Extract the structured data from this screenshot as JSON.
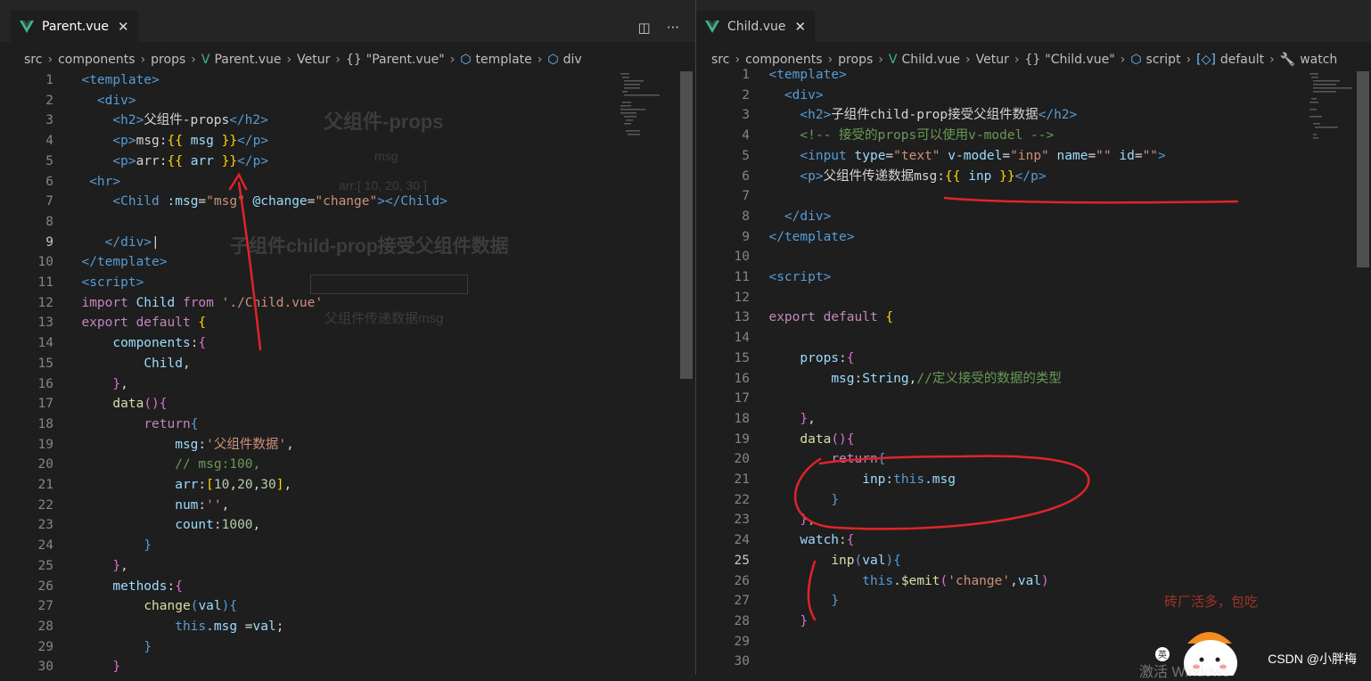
{
  "left": {
    "tab": "Parent.vue",
    "breadcrumb": [
      "src",
      "components",
      "props",
      "Parent.vue",
      "Vetur",
      "\"Parent.vue\"",
      "template",
      "div"
    ],
    "lines": [
      {
        "n": "1",
        "seg": [
          [
            "  ",
            ""
          ],
          [
            "<template>",
            "t-tag"
          ]
        ]
      },
      {
        "n": "2",
        "seg": [
          [
            "    ",
            ""
          ],
          [
            "<div>",
            "t-tag"
          ]
        ]
      },
      {
        "n": "3",
        "seg": [
          [
            "      ",
            ""
          ],
          [
            "<h2>",
            "t-tag"
          ],
          [
            "父组件-props",
            ""
          ],
          [
            "</h2>",
            "t-tag"
          ]
        ]
      },
      {
        "n": "4",
        "seg": [
          [
            "      ",
            ""
          ],
          [
            "<p>",
            "t-tag"
          ],
          [
            "msg:",
            ""
          ],
          [
            "{{ ",
            "t-brace"
          ],
          [
            "msg",
            "t-var"
          ],
          [
            " }}",
            "t-brace"
          ],
          [
            "</p>",
            "t-tag"
          ]
        ]
      },
      {
        "n": "5",
        "seg": [
          [
            "      ",
            ""
          ],
          [
            "<p>",
            "t-tag"
          ],
          [
            "arr:",
            ""
          ],
          [
            "{{ ",
            "t-brace"
          ],
          [
            "arr",
            "t-var"
          ],
          [
            " }}",
            "t-brace"
          ],
          [
            "</p>",
            "t-tag"
          ]
        ]
      },
      {
        "n": "6",
        "seg": [
          [
            "   ",
            ""
          ],
          [
            "<hr>",
            "t-tag"
          ]
        ]
      },
      {
        "n": "7",
        "seg": [
          [
            "      ",
            ""
          ],
          [
            "<Child ",
            "t-tag"
          ],
          [
            ":msg",
            "t-attr"
          ],
          [
            "=",
            ""
          ],
          [
            "\"msg\"",
            "t-str"
          ],
          [
            " ",
            ""
          ],
          [
            "@change",
            "t-attr"
          ],
          [
            "=",
            ""
          ],
          [
            "\"change\"",
            "t-str"
          ],
          [
            "></Child>",
            "t-tag"
          ]
        ]
      },
      {
        "n": "8",
        "seg": []
      },
      {
        "n": "9",
        "seg": [
          [
            "     ",
            ""
          ],
          [
            "</div>",
            "t-tag"
          ],
          [
            "|",
            ""
          ]
        ]
      },
      {
        "n": "10",
        "seg": [
          [
            "  ",
            ""
          ],
          [
            "</template>",
            "t-tag"
          ]
        ]
      },
      {
        "n": "11",
        "seg": [
          [
            "  ",
            ""
          ],
          [
            "<script>",
            "t-tag"
          ]
        ]
      },
      {
        "n": "12",
        "seg": [
          [
            "  ",
            ""
          ],
          [
            "import ",
            "t-kw"
          ],
          [
            "Child ",
            "t-var"
          ],
          [
            "from ",
            "t-kw"
          ],
          [
            "'./Child.vue'",
            "t-str"
          ]
        ]
      },
      {
        "n": "13",
        "seg": [
          [
            "  ",
            ""
          ],
          [
            "export default ",
            "t-kw"
          ],
          [
            "{",
            "t-brace"
          ]
        ]
      },
      {
        "n": "14",
        "seg": [
          [
            "      ",
            ""
          ],
          [
            "components",
            "t-var"
          ],
          [
            ":",
            ""
          ],
          [
            "{",
            "t-purp"
          ]
        ]
      },
      {
        "n": "15",
        "seg": [
          [
            "          ",
            ""
          ],
          [
            "Child",
            "t-var"
          ],
          [
            ",",
            ""
          ]
        ]
      },
      {
        "n": "16",
        "seg": [
          [
            "      ",
            ""
          ],
          [
            "}",
            "t-purp"
          ],
          [
            ",",
            ""
          ]
        ]
      },
      {
        "n": "17",
        "seg": [
          [
            "      ",
            ""
          ],
          [
            "data",
            "t-fn"
          ],
          [
            "(){",
            "t-purp"
          ]
        ]
      },
      {
        "n": "18",
        "seg": [
          [
            "          ",
            ""
          ],
          [
            "return",
            "t-kw"
          ],
          [
            "{",
            "t-tag"
          ]
        ]
      },
      {
        "n": "19",
        "seg": [
          [
            "              ",
            ""
          ],
          [
            "msg",
            "t-var"
          ],
          [
            ":",
            ""
          ],
          [
            "'父组件数据'",
            "t-str"
          ],
          [
            ",",
            ""
          ]
        ]
      },
      {
        "n": "20",
        "seg": [
          [
            "              ",
            ""
          ],
          [
            "// msg:100,",
            "t-cmt"
          ]
        ]
      },
      {
        "n": "21",
        "seg": [
          [
            "              ",
            ""
          ],
          [
            "arr",
            "t-var"
          ],
          [
            ":",
            ""
          ],
          [
            "[",
            "t-brace"
          ],
          [
            "10",
            "t-num"
          ],
          [
            ",",
            ""
          ],
          [
            "20",
            "t-num"
          ],
          [
            ",",
            ""
          ],
          [
            "30",
            "t-num"
          ],
          [
            "]",
            "t-brace"
          ],
          [
            ",",
            ""
          ]
        ]
      },
      {
        "n": "22",
        "seg": [
          [
            "              ",
            ""
          ],
          [
            "num",
            "t-var"
          ],
          [
            ":",
            ""
          ],
          [
            "''",
            "t-str"
          ],
          [
            ",",
            ""
          ]
        ]
      },
      {
        "n": "23",
        "seg": [
          [
            "              ",
            ""
          ],
          [
            "count",
            "t-var"
          ],
          [
            ":",
            ""
          ],
          [
            "1000",
            "t-num"
          ],
          [
            ",",
            ""
          ]
        ]
      },
      {
        "n": "24",
        "seg": [
          [
            "          ",
            ""
          ],
          [
            "}",
            "t-tag"
          ]
        ]
      },
      {
        "n": "25",
        "seg": [
          [
            "      ",
            ""
          ],
          [
            "}",
            "t-purp"
          ],
          [
            ",",
            ""
          ]
        ]
      },
      {
        "n": "26",
        "seg": [
          [
            "      ",
            ""
          ],
          [
            "methods",
            "t-var"
          ],
          [
            ":",
            ""
          ],
          [
            "{",
            "t-purp"
          ]
        ]
      },
      {
        "n": "27",
        "seg": [
          [
            "          ",
            ""
          ],
          [
            "change",
            "t-fn"
          ],
          [
            "(",
            "t-tag"
          ],
          [
            "val",
            "t-var"
          ],
          [
            "){",
            "t-tag"
          ]
        ]
      },
      {
        "n": "28",
        "seg": [
          [
            "              ",
            ""
          ],
          [
            "this",
            "t-this"
          ],
          [
            ".msg ",
            "t-var"
          ],
          [
            "=",
            ""
          ],
          [
            "val",
            "t-var"
          ],
          [
            ";",
            ""
          ]
        ]
      },
      {
        "n": "29",
        "seg": [
          [
            "          ",
            ""
          ],
          [
            "}",
            "t-tag"
          ]
        ]
      },
      {
        "n": "30",
        "seg": [
          [
            "      ",
            ""
          ],
          [
            "}",
            "t-purp"
          ]
        ]
      }
    ],
    "ghost": {
      "title": "父组件-props",
      "msg": "msg",
      "arr": "arr:[ 10, 20, 30 ]",
      "child_title": "子组件child-prop接受父组件数据",
      "child_p": "父组件传递数据msg"
    }
  },
  "right": {
    "tab": "Child.vue",
    "breadcrumb": [
      "src",
      "components",
      "props",
      "Child.vue",
      "Vetur",
      "\"Child.vue\"",
      "script",
      "default",
      "watch"
    ],
    "lines": [
      {
        "n": "1",
        "seg": [
          [
            "  ",
            ""
          ],
          [
            "<template>",
            "t-tag"
          ]
        ]
      },
      {
        "n": "2",
        "seg": [
          [
            "    ",
            ""
          ],
          [
            "<div>",
            "t-tag"
          ]
        ]
      },
      {
        "n": "3",
        "seg": [
          [
            "      ",
            ""
          ],
          [
            "<h2>",
            "t-tag"
          ],
          [
            "子组件child-prop接受父组件数据",
            ""
          ],
          [
            "</h2>",
            "t-tag"
          ]
        ]
      },
      {
        "n": "4",
        "seg": [
          [
            "      ",
            ""
          ],
          [
            "<!-- 接受的props可以使用v-model -->",
            "t-cmt"
          ]
        ]
      },
      {
        "n": "5",
        "seg": [
          [
            "      ",
            ""
          ],
          [
            "<input ",
            "t-tag"
          ],
          [
            "type",
            "t-attr"
          ],
          [
            "=",
            ""
          ],
          [
            "\"text\"",
            "t-str"
          ],
          [
            " ",
            ""
          ],
          [
            "v-model",
            "t-attr"
          ],
          [
            "=",
            ""
          ],
          [
            "\"inp\"",
            "t-str"
          ],
          [
            " ",
            ""
          ],
          [
            "name",
            "t-attr"
          ],
          [
            "=",
            ""
          ],
          [
            "\"\"",
            "t-str"
          ],
          [
            " ",
            ""
          ],
          [
            "id",
            "t-attr"
          ],
          [
            "=",
            ""
          ],
          [
            "\"\"",
            "t-str"
          ],
          [
            ">",
            "t-tag"
          ]
        ]
      },
      {
        "n": "6",
        "seg": [
          [
            "      ",
            ""
          ],
          [
            "<p>",
            "t-tag"
          ],
          [
            "父组件传递数据msg:",
            ""
          ],
          [
            "{{ ",
            "t-brace"
          ],
          [
            "inp",
            "t-var"
          ],
          [
            " }}",
            "t-brace"
          ],
          [
            "</p>",
            "t-tag"
          ]
        ]
      },
      {
        "n": "7",
        "seg": []
      },
      {
        "n": "8",
        "seg": [
          [
            "    ",
            ""
          ],
          [
            "</div>",
            "t-tag"
          ]
        ]
      },
      {
        "n": "9",
        "seg": [
          [
            "  ",
            ""
          ],
          [
            "</template>",
            "t-tag"
          ]
        ]
      },
      {
        "n": "10",
        "seg": []
      },
      {
        "n": "11",
        "seg": [
          [
            "  ",
            ""
          ],
          [
            "<script>",
            "t-tag"
          ]
        ]
      },
      {
        "n": "12",
        "seg": []
      },
      {
        "n": "13",
        "seg": [
          [
            "  ",
            ""
          ],
          [
            "export default ",
            "t-kw"
          ],
          [
            "{",
            "t-brace"
          ]
        ]
      },
      {
        "n": "14",
        "seg": []
      },
      {
        "n": "15",
        "seg": [
          [
            "      ",
            ""
          ],
          [
            "props",
            "t-var"
          ],
          [
            ":",
            ""
          ],
          [
            "{",
            "t-purp"
          ]
        ]
      },
      {
        "n": "16",
        "seg": [
          [
            "          ",
            ""
          ],
          [
            "msg",
            "t-var"
          ],
          [
            ":",
            ""
          ],
          [
            "String",
            "t-var"
          ],
          [
            ",",
            ""
          ],
          [
            "//定义接受的数据的类型",
            "t-cmt"
          ]
        ]
      },
      {
        "n": "17",
        "seg": []
      },
      {
        "n": "18",
        "seg": [
          [
            "      ",
            ""
          ],
          [
            "}",
            "t-purp"
          ],
          [
            ",",
            ""
          ]
        ]
      },
      {
        "n": "19",
        "seg": [
          [
            "      ",
            ""
          ],
          [
            "data",
            "t-fn"
          ],
          [
            "(){",
            "t-purp"
          ]
        ]
      },
      {
        "n": "20",
        "seg": [
          [
            "          ",
            ""
          ],
          [
            "return",
            "t-kw"
          ],
          [
            "{",
            "t-tag"
          ]
        ]
      },
      {
        "n": "21",
        "seg": [
          [
            "              ",
            ""
          ],
          [
            "inp",
            "t-var"
          ],
          [
            ":",
            ""
          ],
          [
            "this",
            "t-this"
          ],
          [
            ".msg",
            "t-var"
          ]
        ]
      },
      {
        "n": "22",
        "seg": [
          [
            "          ",
            ""
          ],
          [
            "}",
            "t-tag"
          ]
        ]
      },
      {
        "n": "23",
        "seg": [
          [
            "      ",
            ""
          ],
          [
            "}",
            "t-purp"
          ],
          [
            ",",
            ""
          ]
        ]
      },
      {
        "n": "24",
        "seg": [
          [
            "      ",
            ""
          ],
          [
            "watch",
            "t-var"
          ],
          [
            ":",
            ""
          ],
          [
            "{",
            "t-purp"
          ]
        ]
      },
      {
        "n": "25",
        "seg": [
          [
            "          ",
            ""
          ],
          [
            "inp",
            "t-fn"
          ],
          [
            "(",
            "t-tag"
          ],
          [
            "val",
            "t-var"
          ],
          [
            "){",
            "t-tag"
          ]
        ]
      },
      {
        "n": "26",
        "seg": [
          [
            "              ",
            ""
          ],
          [
            "this",
            "t-this"
          ],
          [
            ".$emit",
            "t-fn"
          ],
          [
            "(",
            "t-purp"
          ],
          [
            "'change'",
            "t-str"
          ],
          [
            ",",
            ""
          ],
          [
            "val",
            "t-var"
          ],
          [
            ")",
            "t-purp"
          ]
        ]
      },
      {
        "n": "27",
        "seg": [
          [
            "          ",
            ""
          ],
          [
            "}",
            "t-tag"
          ]
        ]
      },
      {
        "n": "28",
        "seg": [
          [
            "      ",
            ""
          ],
          [
            "}",
            "t-purp"
          ]
        ]
      },
      {
        "n": "29",
        "seg": []
      },
      {
        "n": "30",
        "seg": []
      }
    ]
  },
  "overlay": {
    "handnote": "砖厂活多，包吃",
    "mascot_badge": "英",
    "activate": "激活 Windows",
    "watermark": "CSDN @小胖梅"
  },
  "colors": {
    "annotation": "#e0242a",
    "editor_bg": "#1e1e1e",
    "tabbar_bg": "#252526"
  }
}
